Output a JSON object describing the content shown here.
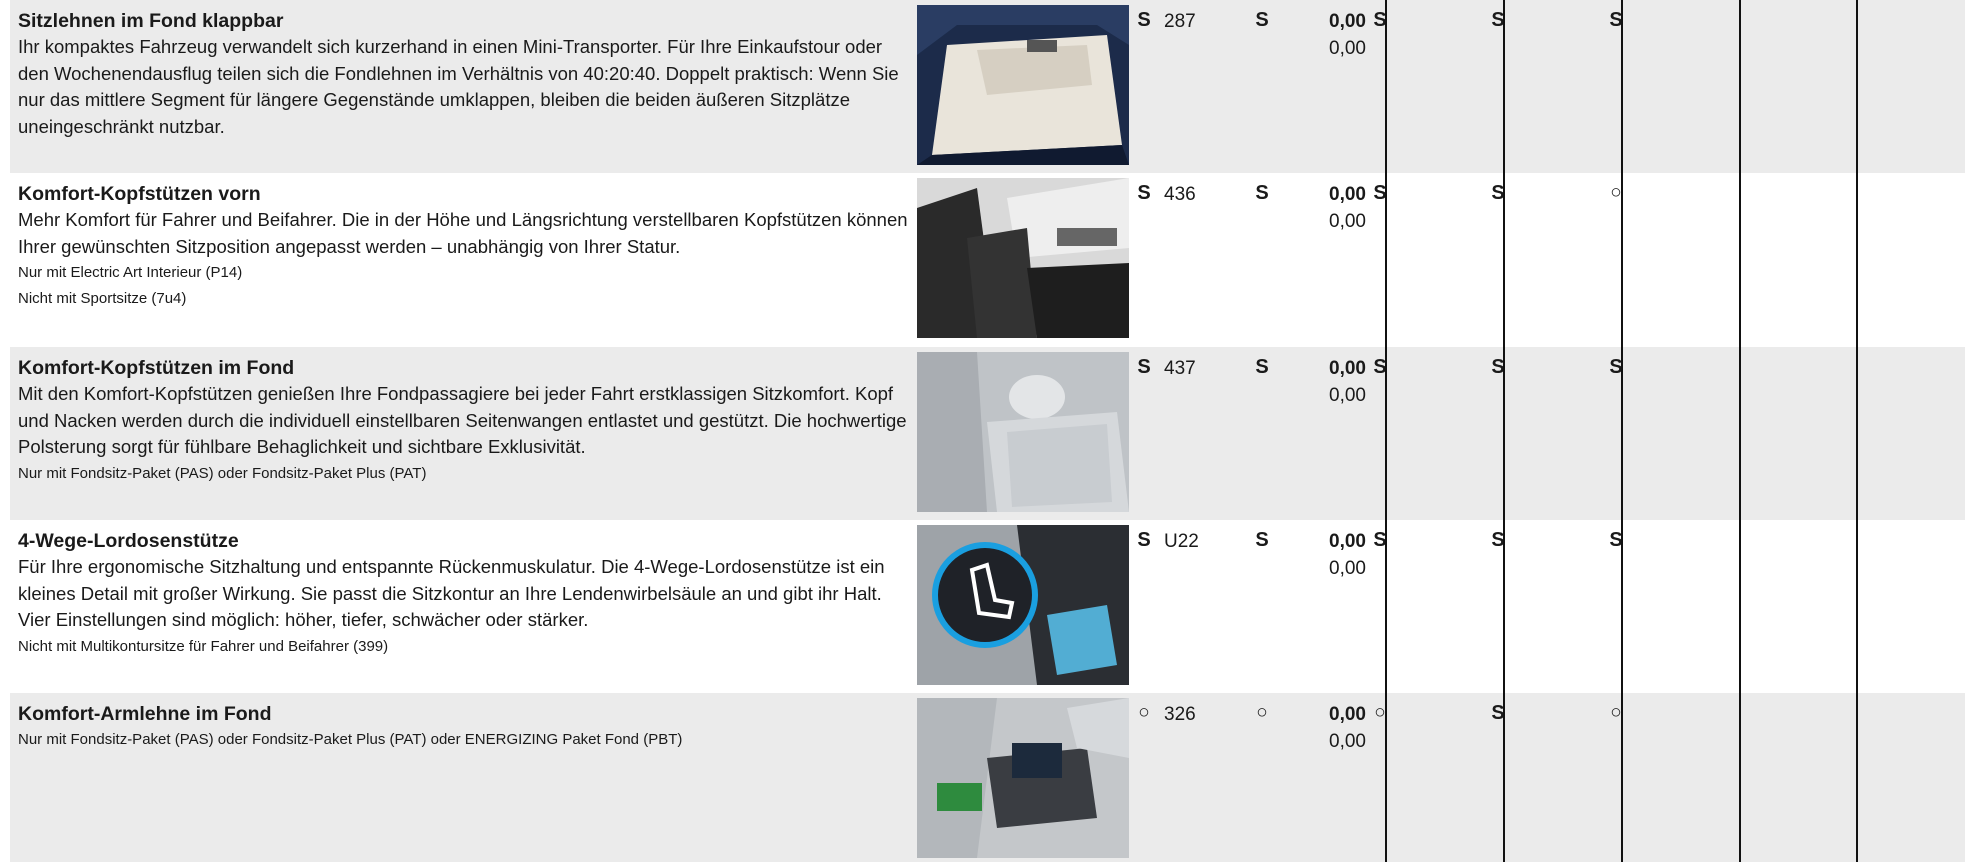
{
  "rows": [
    {
      "title": "Sitzlehnen im Fond klappbar",
      "body": "Ihr kompaktes Fahrzeug verwandelt sich kurzerhand in einen Mini-Transporter. Für Ihre Einkaufstour oder den Wochenendausflug teilen sich die Fondlehnen im Verhältnis von 40:20:40. Doppelt praktisch: Wenn Sie nur das mittlere Segment für längere Gegenstände umklappen, bleiben die beiden äußeren Sitzplätze uneingeschränkt nutzbar.",
      "notes": [],
      "code": "287",
      "price1": "0,00",
      "price2": "0,00",
      "marks": [
        "S",
        "S",
        "S",
        "S",
        "S"
      ]
    },
    {
      "title": "Komfort-Kopfstützen vorn",
      "body": "Mehr Komfort für Fahrer und Beifahrer. Die in der Höhe und Längsrichtung verstellbaren Kopfstützen können Ihrer gewünschten Sitzposition angepasst werden – unabhängig von Ihrer Statur.",
      "notes": [
        "Nur mit Electric Art Interieur (P14)",
        "Nicht mit Sportsitze (7u4)"
      ],
      "code": "436",
      "price1": "0,00",
      "price2": "0,00",
      "marks": [
        "S",
        "S",
        "S",
        "S",
        "○"
      ]
    },
    {
      "title": "Komfort-Kopfstützen im Fond",
      "body": "Mit den Komfort-Kopfstützen genießen Ihre Fondpassagiere bei jeder Fahrt erstklassigen Sitzkomfort. Kopf und Nacken werden durch die individuell einstellbaren Seitenwangen entlastet und gestützt. Die hochwertige Polsterung sorgt für fühlbare Behaglichkeit und sichtbare Exklusivität.",
      "notes": [
        "Nur mit Fondsitz-Paket (PAS) oder Fondsitz-Paket Plus (PAT)"
      ],
      "code": "437",
      "price1": "0,00",
      "price2": "0,00",
      "marks": [
        "S",
        "S",
        "S",
        "S",
        "S"
      ]
    },
    {
      "title": "4-Wege-Lordosenstütze",
      "body": "Für Ihre ergonomische Sitzhaltung und entspannte Rückenmuskulatur. Die 4-Wege-Lordosenstütze ist ein kleines Detail mit großer Wirkung. Sie passt die Sitzkontur an Ihre Lendenwirbelsäule an und gibt ihr Halt. Vier Einstellungen sind möglich: höher, tiefer, schwächer oder stärker.",
      "notes": [
        "Nicht mit Multikontursitze für Fahrer und Beifahrer (399)"
      ],
      "code": "U22",
      "price1": "0,00",
      "price2": "0,00",
      "marks": [
        "S",
        "S",
        "S",
        "S",
        "S"
      ]
    },
    {
      "title": "Komfort-Armlehne im Fond",
      "body": "",
      "notes": [
        "Nur mit Fondsitz-Paket (PAS) oder Fondsitz-Paket Plus (PAT) oder ENERGIZING Paket Fond (PBT)"
      ],
      "code": "326",
      "price1": "0,00",
      "price2": "0,00",
      "marks": [
        "○",
        "○",
        "○",
        "S",
        "○"
      ]
    }
  ]
}
